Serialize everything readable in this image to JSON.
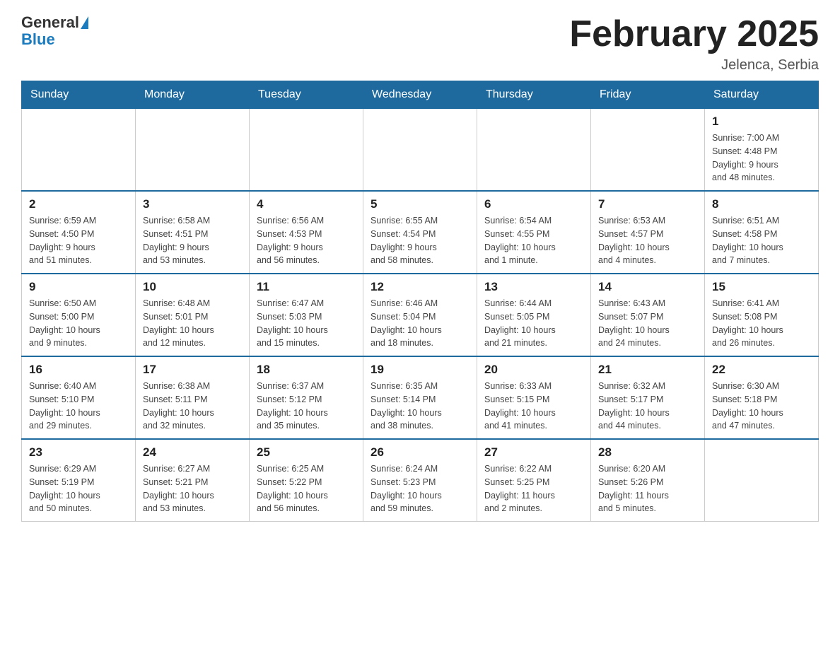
{
  "header": {
    "logo_general": "General",
    "logo_blue": "Blue",
    "month_title": "February 2025",
    "location": "Jelenca, Serbia"
  },
  "days_of_week": [
    "Sunday",
    "Monday",
    "Tuesday",
    "Wednesday",
    "Thursday",
    "Friday",
    "Saturday"
  ],
  "weeks": [
    [
      {
        "day": "",
        "info": ""
      },
      {
        "day": "",
        "info": ""
      },
      {
        "day": "",
        "info": ""
      },
      {
        "day": "",
        "info": ""
      },
      {
        "day": "",
        "info": ""
      },
      {
        "day": "",
        "info": ""
      },
      {
        "day": "1",
        "info": "Sunrise: 7:00 AM\nSunset: 4:48 PM\nDaylight: 9 hours\nand 48 minutes."
      }
    ],
    [
      {
        "day": "2",
        "info": "Sunrise: 6:59 AM\nSunset: 4:50 PM\nDaylight: 9 hours\nand 51 minutes."
      },
      {
        "day": "3",
        "info": "Sunrise: 6:58 AM\nSunset: 4:51 PM\nDaylight: 9 hours\nand 53 minutes."
      },
      {
        "day": "4",
        "info": "Sunrise: 6:56 AM\nSunset: 4:53 PM\nDaylight: 9 hours\nand 56 minutes."
      },
      {
        "day": "5",
        "info": "Sunrise: 6:55 AM\nSunset: 4:54 PM\nDaylight: 9 hours\nand 58 minutes."
      },
      {
        "day": "6",
        "info": "Sunrise: 6:54 AM\nSunset: 4:55 PM\nDaylight: 10 hours\nand 1 minute."
      },
      {
        "day": "7",
        "info": "Sunrise: 6:53 AM\nSunset: 4:57 PM\nDaylight: 10 hours\nand 4 minutes."
      },
      {
        "day": "8",
        "info": "Sunrise: 6:51 AM\nSunset: 4:58 PM\nDaylight: 10 hours\nand 7 minutes."
      }
    ],
    [
      {
        "day": "9",
        "info": "Sunrise: 6:50 AM\nSunset: 5:00 PM\nDaylight: 10 hours\nand 9 minutes."
      },
      {
        "day": "10",
        "info": "Sunrise: 6:48 AM\nSunset: 5:01 PM\nDaylight: 10 hours\nand 12 minutes."
      },
      {
        "day": "11",
        "info": "Sunrise: 6:47 AM\nSunset: 5:03 PM\nDaylight: 10 hours\nand 15 minutes."
      },
      {
        "day": "12",
        "info": "Sunrise: 6:46 AM\nSunset: 5:04 PM\nDaylight: 10 hours\nand 18 minutes."
      },
      {
        "day": "13",
        "info": "Sunrise: 6:44 AM\nSunset: 5:05 PM\nDaylight: 10 hours\nand 21 minutes."
      },
      {
        "day": "14",
        "info": "Sunrise: 6:43 AM\nSunset: 5:07 PM\nDaylight: 10 hours\nand 24 minutes."
      },
      {
        "day": "15",
        "info": "Sunrise: 6:41 AM\nSunset: 5:08 PM\nDaylight: 10 hours\nand 26 minutes."
      }
    ],
    [
      {
        "day": "16",
        "info": "Sunrise: 6:40 AM\nSunset: 5:10 PM\nDaylight: 10 hours\nand 29 minutes."
      },
      {
        "day": "17",
        "info": "Sunrise: 6:38 AM\nSunset: 5:11 PM\nDaylight: 10 hours\nand 32 minutes."
      },
      {
        "day": "18",
        "info": "Sunrise: 6:37 AM\nSunset: 5:12 PM\nDaylight: 10 hours\nand 35 minutes."
      },
      {
        "day": "19",
        "info": "Sunrise: 6:35 AM\nSunset: 5:14 PM\nDaylight: 10 hours\nand 38 minutes."
      },
      {
        "day": "20",
        "info": "Sunrise: 6:33 AM\nSunset: 5:15 PM\nDaylight: 10 hours\nand 41 minutes."
      },
      {
        "day": "21",
        "info": "Sunrise: 6:32 AM\nSunset: 5:17 PM\nDaylight: 10 hours\nand 44 minutes."
      },
      {
        "day": "22",
        "info": "Sunrise: 6:30 AM\nSunset: 5:18 PM\nDaylight: 10 hours\nand 47 minutes."
      }
    ],
    [
      {
        "day": "23",
        "info": "Sunrise: 6:29 AM\nSunset: 5:19 PM\nDaylight: 10 hours\nand 50 minutes."
      },
      {
        "day": "24",
        "info": "Sunrise: 6:27 AM\nSunset: 5:21 PM\nDaylight: 10 hours\nand 53 minutes."
      },
      {
        "day": "25",
        "info": "Sunrise: 6:25 AM\nSunset: 5:22 PM\nDaylight: 10 hours\nand 56 minutes."
      },
      {
        "day": "26",
        "info": "Sunrise: 6:24 AM\nSunset: 5:23 PM\nDaylight: 10 hours\nand 59 minutes."
      },
      {
        "day": "27",
        "info": "Sunrise: 6:22 AM\nSunset: 5:25 PM\nDaylight: 11 hours\nand 2 minutes."
      },
      {
        "day": "28",
        "info": "Sunrise: 6:20 AM\nSunset: 5:26 PM\nDaylight: 11 hours\nand 5 minutes."
      },
      {
        "day": "",
        "info": ""
      }
    ]
  ]
}
